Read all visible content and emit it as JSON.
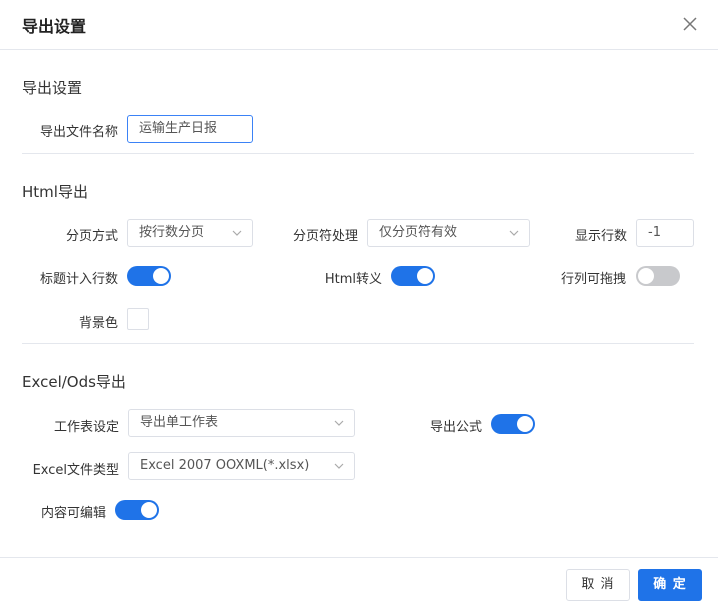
{
  "dialog": {
    "title": "导出设置",
    "close_icon": "close-icon"
  },
  "export_settings": {
    "heading": "导出设置",
    "filename_label": "导出文件名称",
    "filename_value": "运输生产日报"
  },
  "html_export": {
    "heading": "Html导出",
    "paging_label": "分页方式",
    "paging_value": "按行数分页",
    "page_break_label": "分页符处理",
    "page_break_value": "仅分页符有效",
    "rows_label": "显示行数",
    "rows_value": "-1",
    "title_rows_label": "标题计入行数",
    "title_rows_on": true,
    "html_escape_label": "Html转义",
    "html_escape_on": true,
    "draggable_label": "行列可拖拽",
    "draggable_on": false,
    "bg_label": "背景色",
    "bg_color": "#ffffff"
  },
  "excel_export": {
    "heading": "Excel/Ods导出",
    "sheet_label": "工作表设定",
    "sheet_value": "导出单工作表",
    "formula_label": "导出公式",
    "formula_on": true,
    "filetype_label": "Excel文件类型",
    "filetype_value": "Excel 2007 OOXML(*.xlsx)",
    "editable_label": "内容可编辑",
    "editable_on": true
  },
  "footer": {
    "cancel_label": "取 消",
    "ok_label": "确 定"
  },
  "colors": {
    "accent": "#1f73e8",
    "border": "#dcdfe6",
    "toggle_off": "#c8c9cc"
  }
}
